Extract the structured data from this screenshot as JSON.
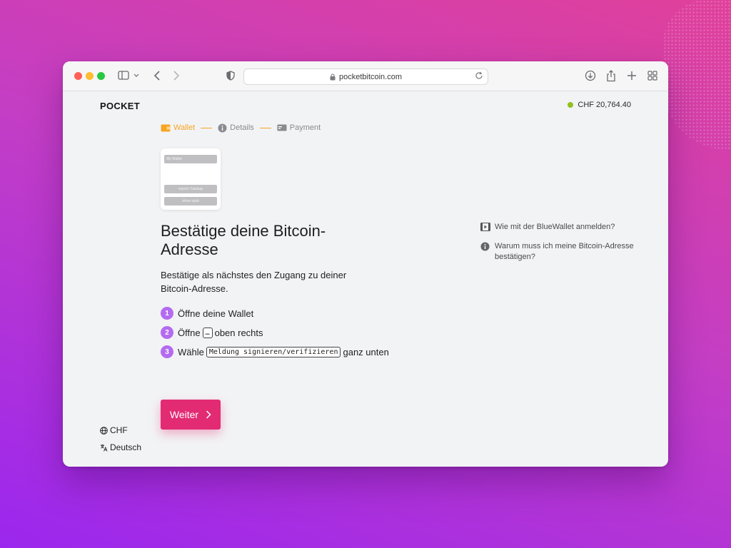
{
  "browser": {
    "url": "pocketbitcoin.com"
  },
  "header": {
    "logo": "POCKET",
    "balance": "CHF 20,764.40",
    "balance_dot_color": "#93c01f"
  },
  "steps": [
    {
      "label": "Wallet",
      "icon": "wallet-icon",
      "active": true
    },
    {
      "label": "Details",
      "icon": "info-icon",
      "active": false
    },
    {
      "label": "Payment",
      "icon": "payment-icon",
      "active": false
    }
  ],
  "preview": {
    "wallet_name": "My Wallet",
    "button1": "export / backup",
    "button2": "show xpub"
  },
  "main": {
    "title": "Bestätige deine Bitcoin-Adresse",
    "intro": "Bestätige als nächstes den Zugang zu deiner Bitcoin-Adresse.",
    "instructions": [
      {
        "num": "1",
        "text": "Öffne deine Wallet"
      },
      {
        "num": "2",
        "pre": "Öffne",
        "code": "…",
        "post": "oben rechts"
      },
      {
        "num": "3",
        "pre": "Wähle",
        "code": "Meldung signieren/verifizieren",
        "post": "ganz unten"
      }
    ],
    "cta_label": "Weiter",
    "cta_color": "#e22b73"
  },
  "help": [
    {
      "icon": "video-icon",
      "text": "Wie mit der BlueWallet anmelden?"
    },
    {
      "icon": "info-icon",
      "text": "Warum muss ich meine Bitcoin-Adresse bestätigen?"
    }
  ],
  "footer": {
    "currency": "CHF",
    "language": "Deutsch"
  }
}
